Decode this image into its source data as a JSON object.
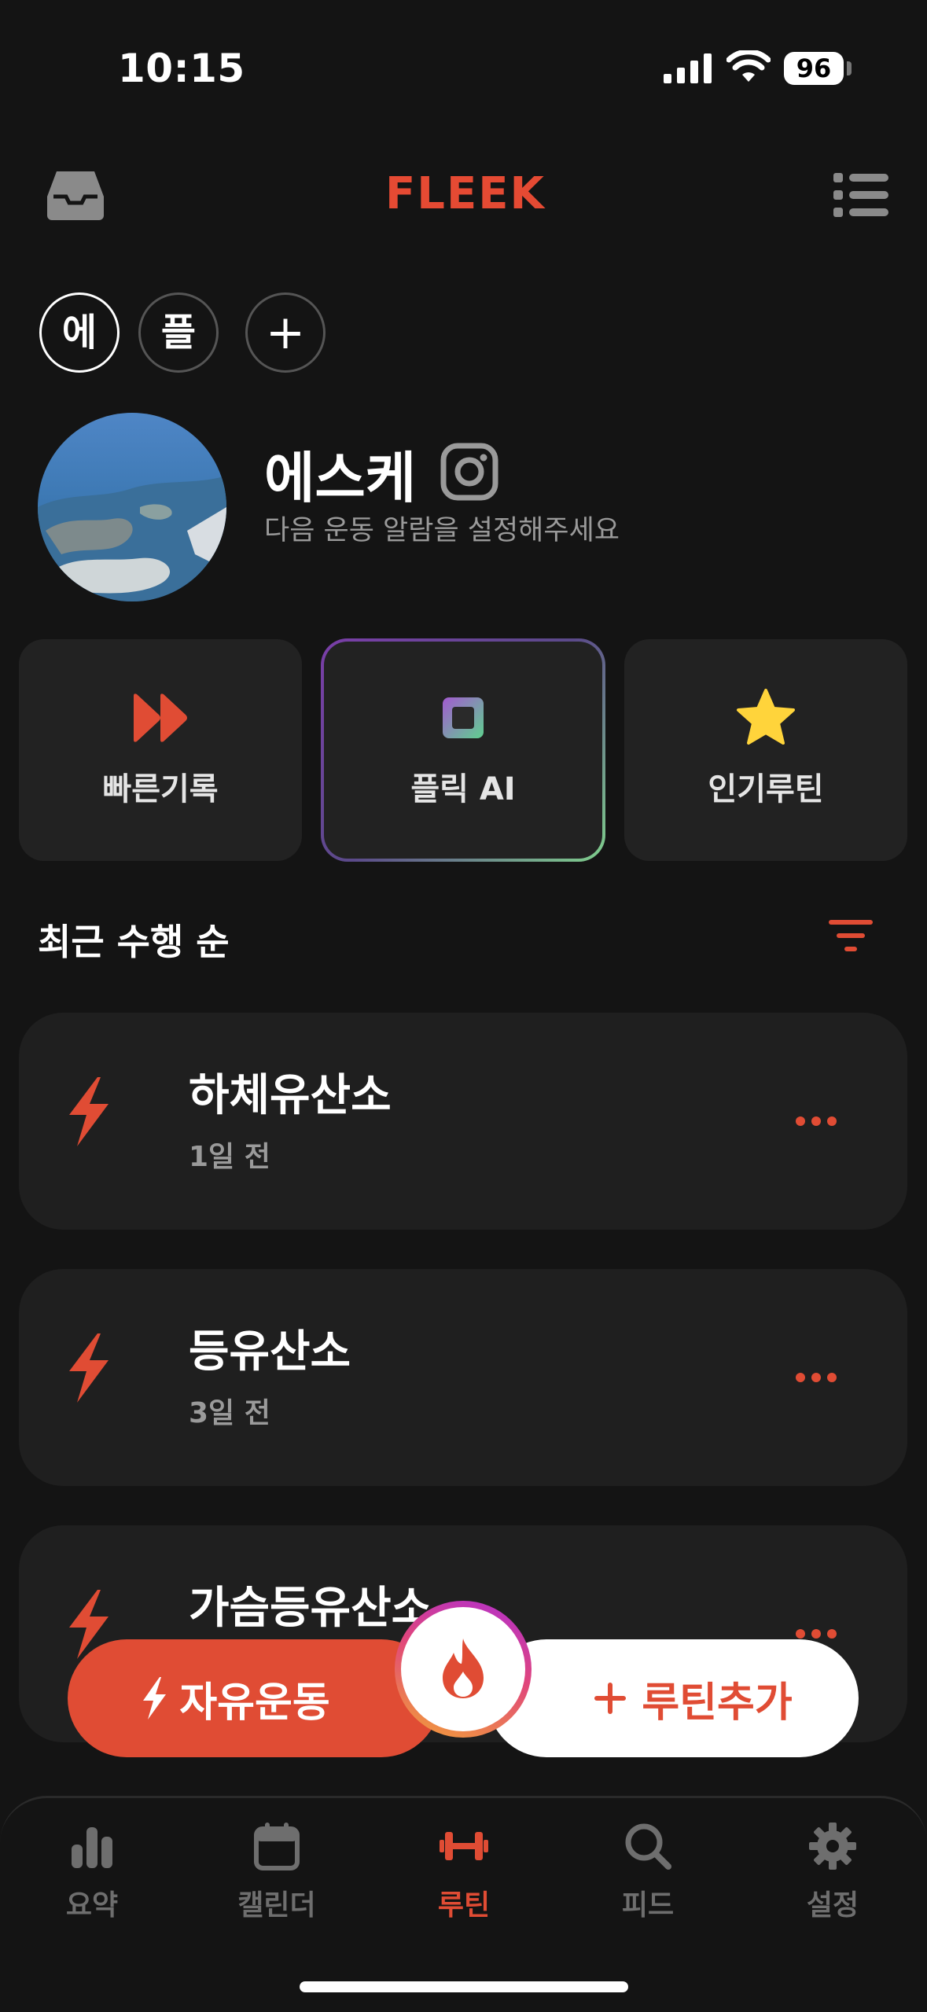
{
  "status_bar": {
    "time": "10:15",
    "battery": "96"
  },
  "header": {
    "brand": "FLEEK"
  },
  "profiles": [
    {
      "label": "에",
      "active": true
    },
    {
      "label": "플",
      "active": false
    }
  ],
  "add_profile_symbol": "+",
  "user": {
    "name": "에스케",
    "subtitle": "다음 운동 알람을 설정해주세요"
  },
  "quick_actions": [
    {
      "label": "빠른기록",
      "icon": "fast-forward-icon"
    },
    {
      "label": "플릭 AI",
      "icon": "chip-icon"
    },
    {
      "label": "인기루틴",
      "icon": "star-icon"
    }
  ],
  "sort": {
    "label": "최근 수행 순"
  },
  "routines": [
    {
      "title": "하체유산소",
      "subtitle": "1일 전"
    },
    {
      "title": "등유산소",
      "subtitle": "3일 전"
    },
    {
      "title": "가슴등유산소",
      "subtitle": ""
    }
  ],
  "actions": {
    "free_workout": "자유운동",
    "add_routine": "루틴추가"
  },
  "tabs": [
    {
      "label": "요약",
      "icon": "bar-chart-icon"
    },
    {
      "label": "캘린더",
      "icon": "calendar-icon"
    },
    {
      "label": "루틴",
      "icon": "dumbbell-icon",
      "active": true
    },
    {
      "label": "피드",
      "icon": "search-icon"
    },
    {
      "label": "설정",
      "icon": "gear-icon"
    }
  ],
  "colors": {
    "accent": "#e04c34",
    "background": "#141414",
    "card": "#1f1f1f",
    "star": "#ffd43b"
  }
}
